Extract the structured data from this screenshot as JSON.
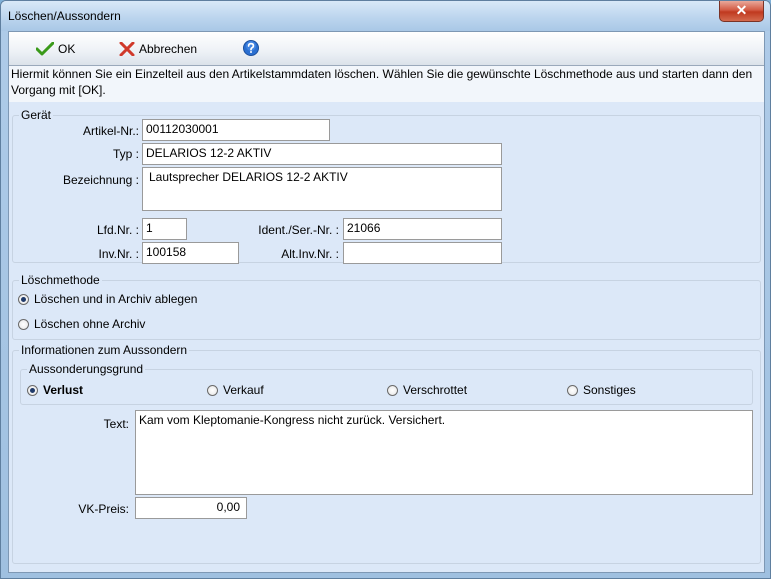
{
  "window": {
    "title": "Löschen/Aussondern",
    "close_label": "✕"
  },
  "toolbar": {
    "ok_label": "OK",
    "cancel_label": "Abbrechen"
  },
  "info": "Hiermit können Sie ein Einzelteil aus den Artikelstammdaten löschen. Wählen Sie die gewünschte Löschmethode aus und starten dann den Vorgang mit [OK].",
  "geraet": {
    "legend": "Gerät",
    "artikel_nr_label": "Artikel-Nr.:",
    "artikel_nr": "00112030001",
    "typ_label": "Typ :",
    "typ": "DELARIOS 12-2 AKTIV",
    "bezeichnung_label": "Bezeichnung :",
    "bezeichnung": "Lautsprecher DELARIOS 12-2 AKTIV",
    "lfd_nr_label": "Lfd.Nr. :",
    "lfd_nr": "1",
    "ident_label": "Ident./Ser.-Nr. :",
    "ident": "21066",
    "inv_nr_label": "Inv.Nr. :",
    "inv_nr": "100158",
    "alt_inv_label": "Alt.Inv.Nr. :",
    "alt_inv": ""
  },
  "loeschmethode": {
    "legend": "Löschmethode",
    "options": [
      {
        "label": "Löschen und in Archiv ablegen",
        "selected": true
      },
      {
        "label": "Löschen ohne Archiv",
        "selected": false
      }
    ]
  },
  "aussondern": {
    "legend": "Informationen zum Aussondern",
    "grund_legend": "Aussonderungsgrund",
    "options": [
      {
        "label": "Verlust",
        "selected": true
      },
      {
        "label": "Verkauf",
        "selected": false
      },
      {
        "label": "Verschrottet",
        "selected": false
      },
      {
        "label": "Sonstiges",
        "selected": false
      }
    ],
    "text_label": "Text:",
    "text": "Kam vom Kleptomanie-Kongress nicht zurück. Versichert.",
    "vk_label": "VK-Preis:",
    "vk": "0,00"
  },
  "colors": {
    "ok_check": "#3a9a1a",
    "cancel_x": "#d0392b",
    "help": "#2a6fd1"
  }
}
